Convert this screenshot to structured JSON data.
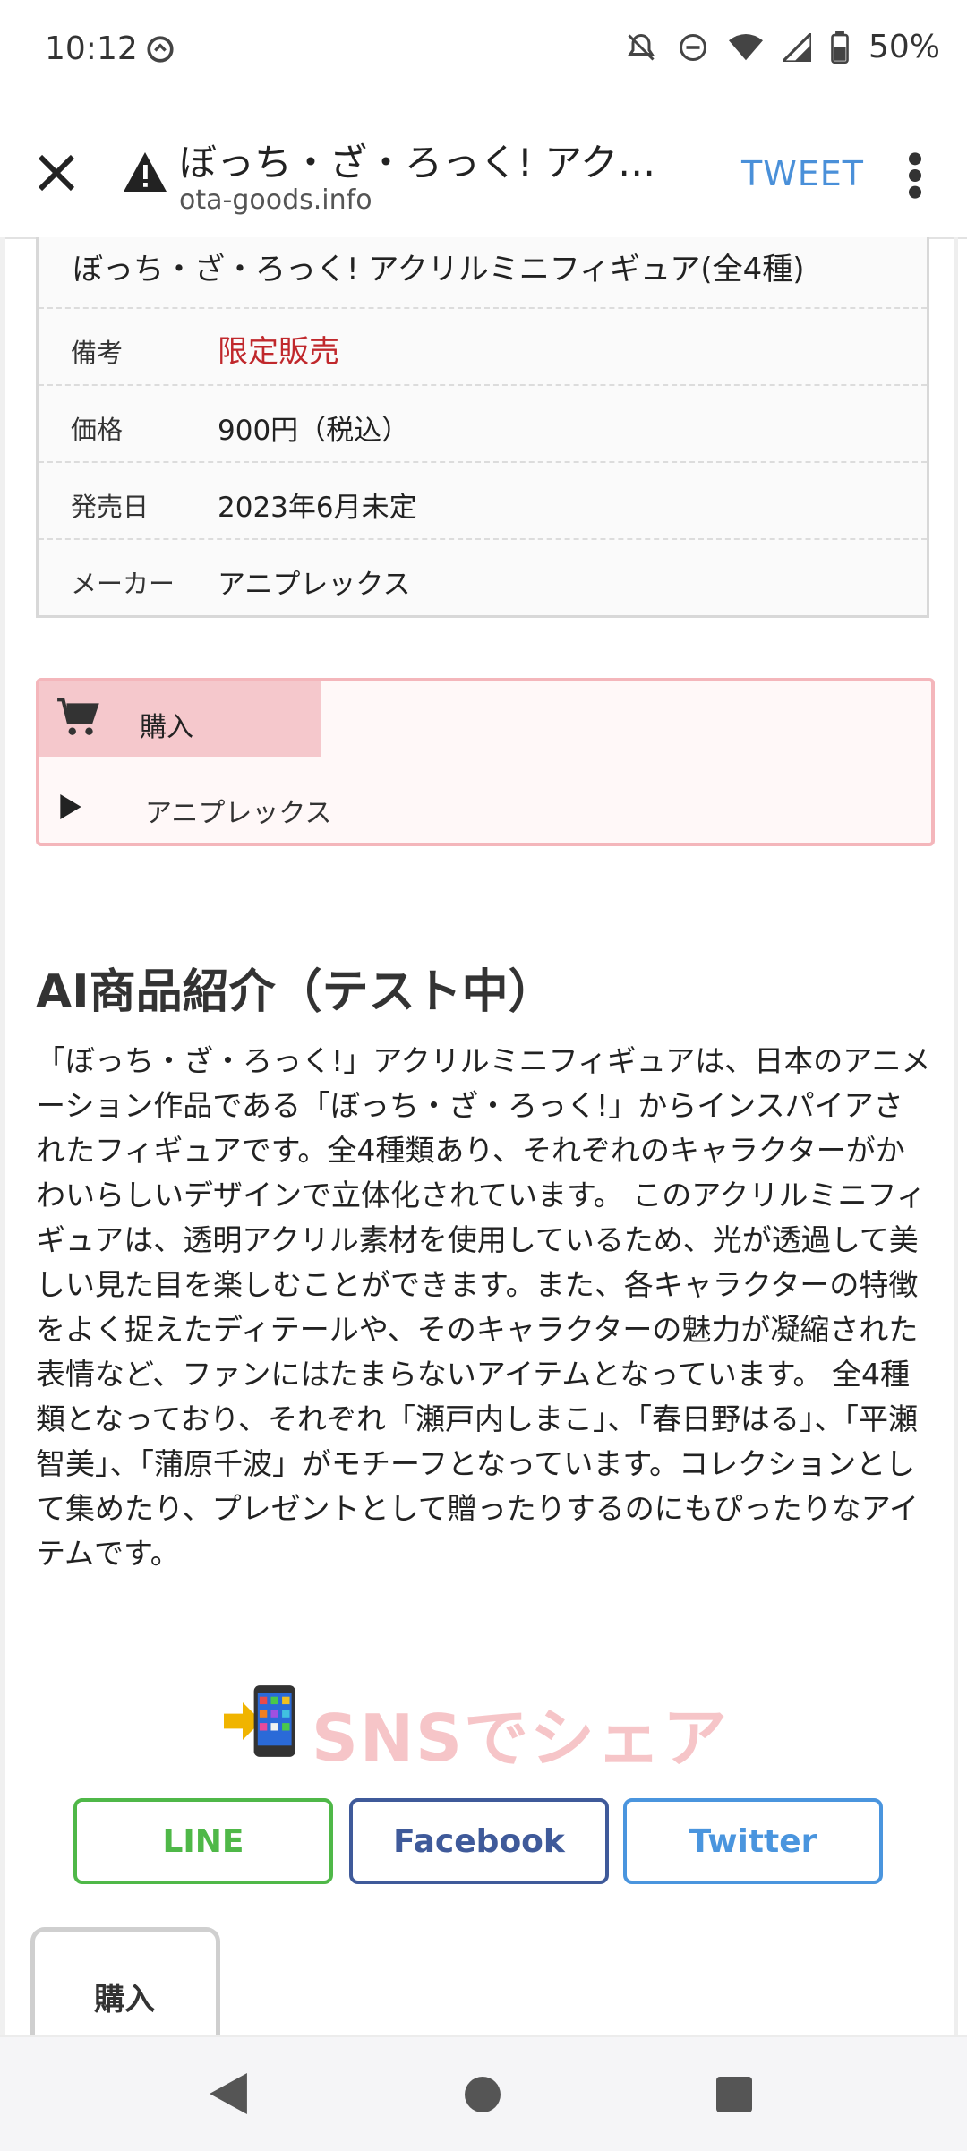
{
  "status_bar": {
    "time": "10:12",
    "battery": "50%",
    "icons": [
      "sync-icon",
      "bell-off-icon",
      "dnd-icon",
      "wifi-icon",
      "signal-icon",
      "battery-icon"
    ]
  },
  "toolbar": {
    "title": "ぼっち・ざ・ろっく! アクリルミニフィギュア(全4種)",
    "url": "ota-goods.info",
    "tweet_label": "TWEET"
  },
  "spec": {
    "product_name": "ぼっち・ざ・ろっく! アクリルミニフィギュア(全4種)",
    "rows": [
      {
        "key": "備考",
        "value": "限定販売"
      },
      {
        "key": "価格",
        "value": "900円（税込）"
      },
      {
        "key": "発売日",
        "value": "2023年6月未定"
      },
      {
        "key": "メーカー",
        "value": "アニプレックス"
      }
    ],
    "highlight_color": "#c0282c"
  },
  "buy_box": {
    "tab_label": "購入",
    "shop_link": "アニプレックス"
  },
  "ai_section": {
    "heading": "AI商品紹介（テスト中）",
    "body": "「ぼっち・ざ・ろっく!」アクリルミニフィギュアは、日本のアニメーション作品である「ぼっち・ざ・ろっく!」からインスパイアされたフィギュアです。全4種類あり、それぞれのキャラクターがかわいらしいデザインで立体化されています。 このアクリルミニフィギュアは、透明アクリル素材を使用しているため、光が透過して美しい見た目を楽しむことができます。また、各キャラクターの特徴をよく捉えたディテールや、そのキャラクターの魅力が凝縮された表情など、ファンにはたまらないアイテムとなっています。 全4種類となっており、それぞれ「瀬戸内しまこ」、「春日野はる」、「平瀬智美」、「蒲原千波」がモチーフとなっています。コレクションとして集めたり、プレゼントとして贈ったりするのにもぴったりなアイテムです。"
  },
  "sns": {
    "title": "SNSでシェア",
    "buttons": {
      "line": "LINE",
      "facebook": "Facebook",
      "twitter": "Twitter"
    },
    "colors": {
      "line": "#4fb848",
      "facebook": "#3f5a9a",
      "twitter": "#4a95de"
    }
  },
  "bottom_tab": {
    "label": "購入"
  }
}
